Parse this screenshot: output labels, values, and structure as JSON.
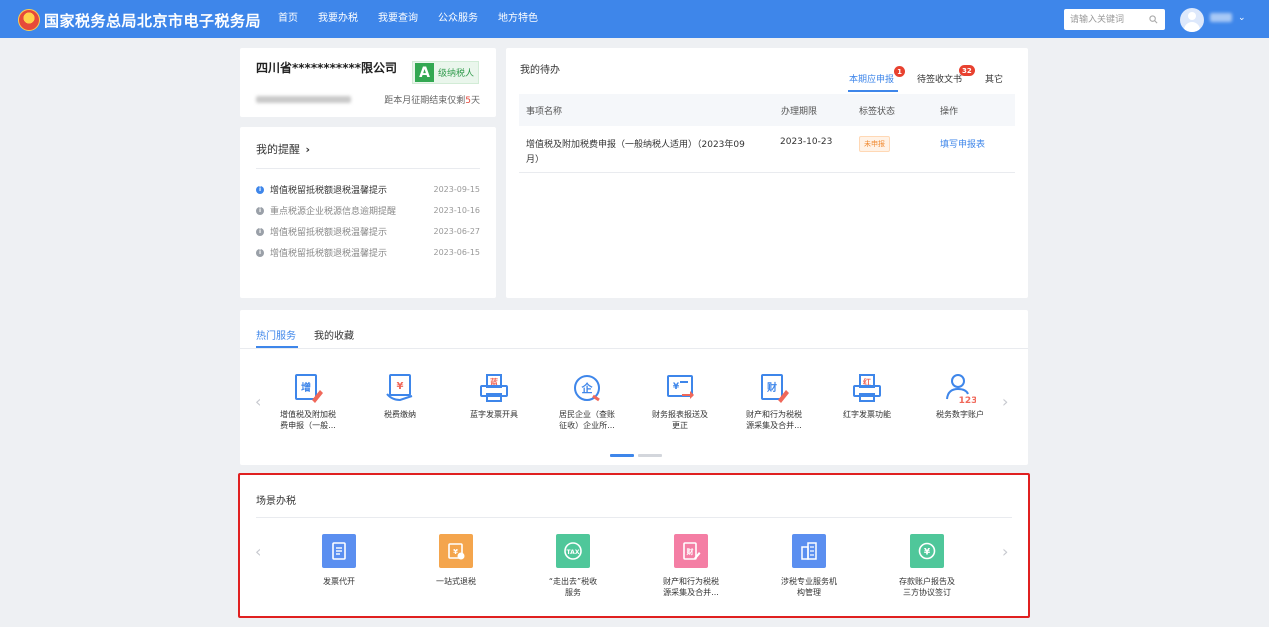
{
  "header": {
    "site_title": "国家税务总局北京市电子税务局",
    "nav": [
      "首页",
      "我要办税",
      "我要查询",
      "公众服务",
      "地方特色"
    ],
    "search_placeholder": "请输入关键词",
    "accent_color": "#3e86ea"
  },
  "company": {
    "name": "四川省***********限公司",
    "grade_letter": "A",
    "grade_label": "级纳税人",
    "deadline_prefix": "距本月征期结束仅剩",
    "deadline_days": "5",
    "deadline_suffix": "天"
  },
  "reminders": {
    "title": "我的提醒",
    "chevron": "›",
    "items": [
      {
        "text": "增值税留抵税额退税温馨提示",
        "date": "2023-09-15"
      },
      {
        "text": "重点税源企业税源信息逾期提醒",
        "date": "2023-10-16"
      },
      {
        "text": "增值税留抵税额退税温馨提示",
        "date": "2023-06-27"
      },
      {
        "text": "增值税留抵税额退税温馨提示",
        "date": "2023-06-15"
      }
    ]
  },
  "todo": {
    "title": "我的待办",
    "tabs": [
      {
        "label": "本期应申报",
        "badge": "1"
      },
      {
        "label": "待签收文书",
        "badge": "32"
      },
      {
        "label": "其它",
        "badge": ""
      }
    ],
    "columns": [
      "事项名称",
      "办理期限",
      "标签状态",
      "操作"
    ],
    "rows": [
      {
        "name_line1": "增值税及附加税费申报（一般纳税人适用）（2023年09",
        "name_line2": "月）",
        "deadline": "2023-10-23",
        "status": "未申报",
        "action": "填写申报表"
      }
    ]
  },
  "hot_services": {
    "tabs": [
      "热门服务",
      "我的收藏"
    ],
    "prev_arrow": "‹",
    "next_arrow": "›",
    "items": [
      {
        "line1": "增值税及附加税",
        "line2": "费申报（一般...",
        "icon": "vat-declare-icon"
      },
      {
        "line1": "税费缴纳",
        "line2": "",
        "icon": "tax-payment-icon"
      },
      {
        "line1": "蓝字发票开具",
        "line2": "",
        "icon": "blue-invoice-icon"
      },
      {
        "line1": "居民企业（查账",
        "line2": "征收）企业所...",
        "icon": "enterprise-tax-icon"
      },
      {
        "line1": "财务报表报送及",
        "line2": "更正",
        "icon": "financial-report-icon"
      },
      {
        "line1": "财产和行为税税",
        "line2": "源采集及合并...",
        "icon": "property-tax-icon"
      },
      {
        "line1": "红字发票功能",
        "line2": "",
        "icon": "red-invoice-icon"
      },
      {
        "line1": "税务数字账户",
        "line2": "",
        "icon": "digital-account-icon"
      }
    ],
    "page_dots": 2,
    "active_dot": 0
  },
  "scene": {
    "title": "场景办税",
    "prev_arrow": "‹",
    "next_arrow": "›",
    "items": [
      {
        "line1": "发票代开",
        "line2": "",
        "icon": "invoice-agent-icon",
        "color": "#5b8ff0"
      },
      {
        "line1": "一站式退税",
        "line2": "",
        "icon": "one-stop-refund-icon",
        "color": "#f4a54d"
      },
      {
        "line1": "“走出去”税收",
        "line2": "服务",
        "icon": "going-global-icon",
        "color": "#4fc79a"
      },
      {
        "line1": "财产和行为税税",
        "line2": "源采集及合并...",
        "icon": "property-tax-scene-icon",
        "color": "#f47ea4"
      },
      {
        "line1": "涉税专业服务机",
        "line2": "构管理",
        "icon": "agency-management-icon",
        "color": "#5b8ff0"
      },
      {
        "line1": "存款账户报告及",
        "line2": "三方协议签订",
        "icon": "bank-account-icon",
        "color": "#4fc79a"
      }
    ],
    "highlight_color": "#e02020"
  }
}
